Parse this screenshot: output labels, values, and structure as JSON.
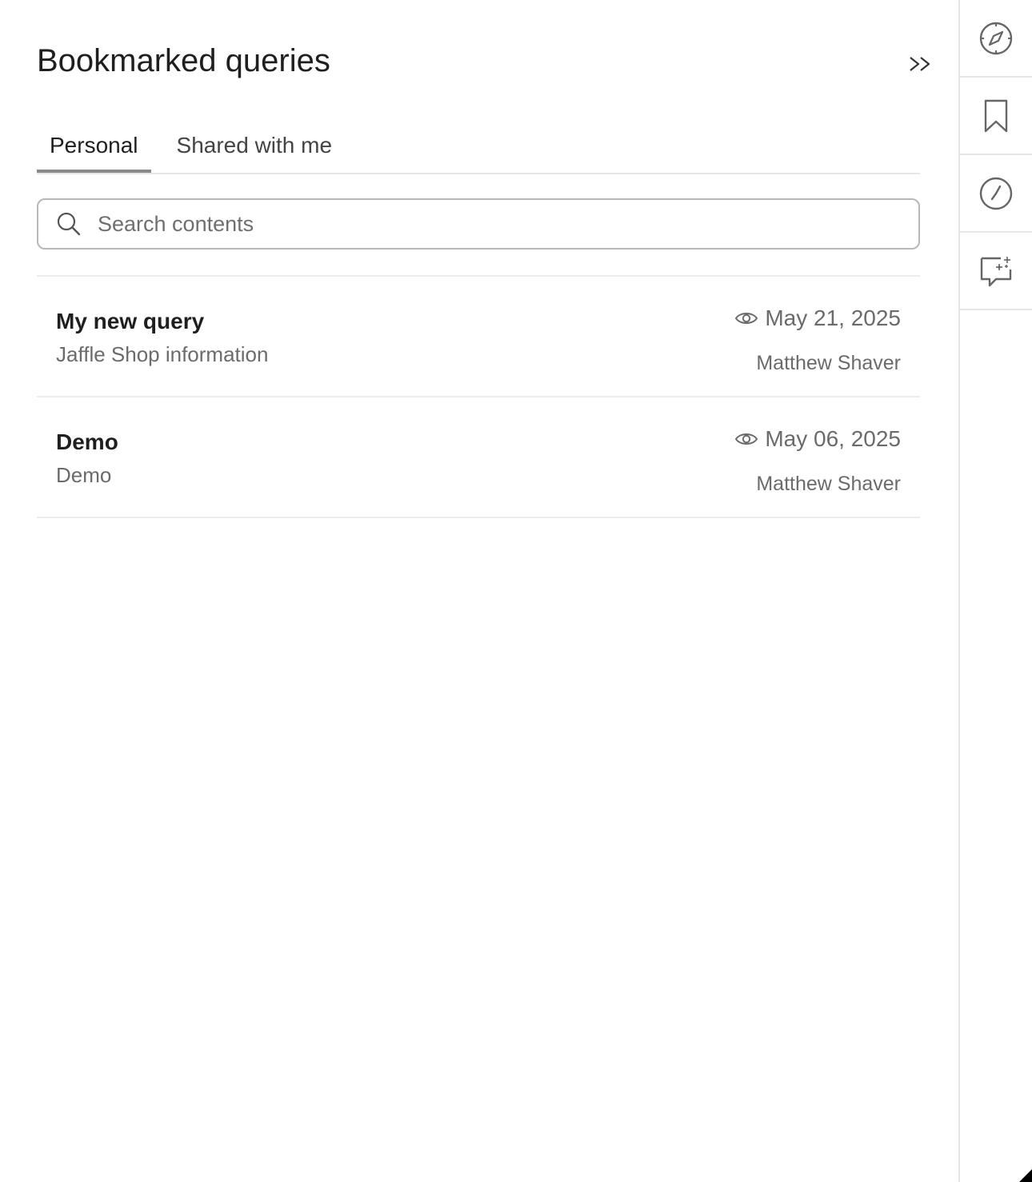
{
  "panel": {
    "title": "Bookmarked queries",
    "collapse_icon": "double-chevron-right-icon"
  },
  "tabs": [
    {
      "label": "Personal",
      "active": true
    },
    {
      "label": "Shared with me",
      "active": false
    }
  ],
  "search": {
    "placeholder": "Search contents",
    "value": ""
  },
  "queries": [
    {
      "title": "My new query",
      "subtitle": "Jaffle Shop information",
      "date": "May 21, 2025",
      "owner": "Matthew Shaver"
    },
    {
      "title": "Demo",
      "subtitle": "Demo",
      "date": "May 06, 2025",
      "owner": "Matthew Shaver"
    }
  ],
  "rail": {
    "items": [
      {
        "icon": "compass-icon"
      },
      {
        "icon": "bookmark-icon"
      },
      {
        "icon": "clock-icon"
      },
      {
        "icon": "ai-chat-icon"
      }
    ]
  },
  "colors": {
    "text_primary": "#1f1f1f",
    "text_secondary": "#6b6b6b",
    "border": "#e6e6e6",
    "tab_indicator": "#8a8a8a"
  }
}
